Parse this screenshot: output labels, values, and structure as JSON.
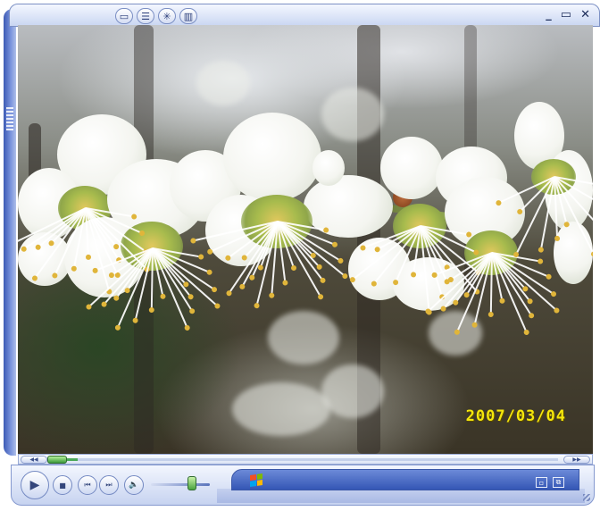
{
  "window": {
    "minimize_icon": "minimize-icon",
    "maximize_icon": "maximize-icon",
    "close_icon": "close-icon"
  },
  "toolbar_buttons": [
    {
      "name": "library-button",
      "icon": "folder-icon"
    },
    {
      "name": "playlist-button",
      "icon": "list-icon"
    },
    {
      "name": "visualization-button",
      "icon": "burst-icon"
    },
    {
      "name": "equalizer-button",
      "icon": "bars-icon"
    }
  ],
  "video": {
    "date_stamp": "2007/03/04",
    "subject": "white plum blossoms"
  },
  "seek": {
    "progress": 0.05
  },
  "controls": {
    "play_icon": "play-icon",
    "stop_icon": "stop-icon",
    "previous_icon": "previous-icon",
    "next_icon": "next-icon",
    "mute_icon": "speaker-icon",
    "volume": 0.7
  },
  "colors": {
    "accent": "#3456b5",
    "seek_fill": "#4ca95a",
    "date_stamp": "#f5e70c"
  }
}
